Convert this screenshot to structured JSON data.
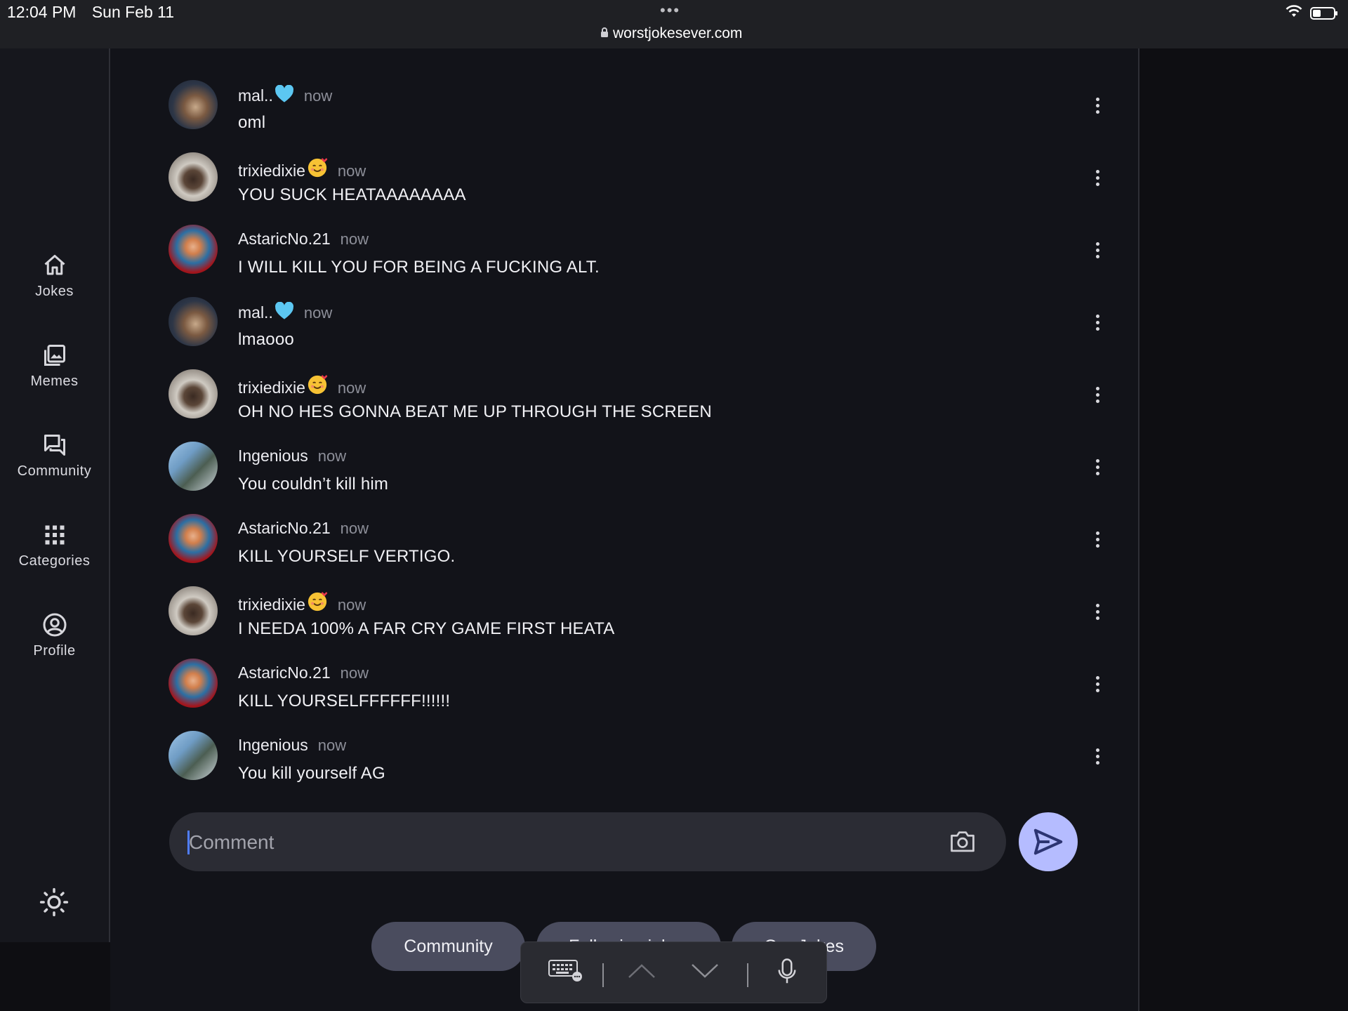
{
  "status_bar": {
    "time": "12:04 PM",
    "date": "Sun Feb 11",
    "url": "worstjokesever.com",
    "dots": "•••"
  },
  "sidebar": {
    "items": [
      {
        "label": "Jokes",
        "icon": "home-icon"
      },
      {
        "label": "Memes",
        "icon": "image-stack-icon"
      },
      {
        "label": "Community",
        "icon": "forum-icon"
      },
      {
        "label": "Categories",
        "icon": "grid-icon"
      },
      {
        "label": "Profile",
        "icon": "account-circle-icon"
      }
    ],
    "theme_icon": "sun-icon"
  },
  "comments": [
    {
      "user": "mal..",
      "emoji": "blue-heart",
      "time": "now",
      "text": "oml",
      "avatar": "mal"
    },
    {
      "user": "trixiedixie",
      "emoji": "smiling-face-with-hearts",
      "time": "now",
      "text": "YOU SUCK HEATAAAAAAAA",
      "avatar": "trixie"
    },
    {
      "user": "AstaricNo.21",
      "emoji": "",
      "time": "now",
      "text": "I WILL KILL YOU FOR BEING A FUCKING ALT.",
      "avatar": "astaric"
    },
    {
      "user": "mal..",
      "emoji": "blue-heart",
      "time": "now",
      "text": "lmaooo",
      "avatar": "mal"
    },
    {
      "user": "trixiedixie",
      "emoji": "smiling-face-with-hearts",
      "time": "now",
      "text": "OH NO HES GONNA BEAT ME UP THROUGH THE SCREEN",
      "avatar": "trixie"
    },
    {
      "user": "Ingenious",
      "emoji": "",
      "time": "now",
      "text": "You couldn’t kill him",
      "avatar": "ingenious"
    },
    {
      "user": "AstaricNo.21",
      "emoji": "",
      "time": "now",
      "text": "KILL YOURSELF VERTIGO.",
      "avatar": "astaric"
    },
    {
      "user": "trixiedixie",
      "emoji": "smiling-face-with-hearts",
      "time": "now",
      "text": "I NEEDA 100% A FAR CRY GAME FIRST HEATA",
      "avatar": "trixie"
    },
    {
      "user": "AstaricNo.21",
      "emoji": "",
      "time": "now",
      "text": "KILL YOURSELFFFFFF!!!!!!",
      "avatar": "astaric"
    },
    {
      "user": "Ingenious",
      "emoji": "",
      "time": "now",
      "text": "You kill yourself AG",
      "avatar": "ingenious"
    }
  ],
  "comment_box": {
    "placeholder": "Comment",
    "value": ""
  },
  "chips": [
    {
      "label": "Community"
    },
    {
      "label": "Following jokes"
    },
    {
      "label": "Our Jokes"
    }
  ],
  "colors": {
    "background": "#121319",
    "sidebar": "#16171d",
    "send_button": "#b5bcff",
    "chip": "#4a4c5e",
    "input": "#2b2c34"
  }
}
